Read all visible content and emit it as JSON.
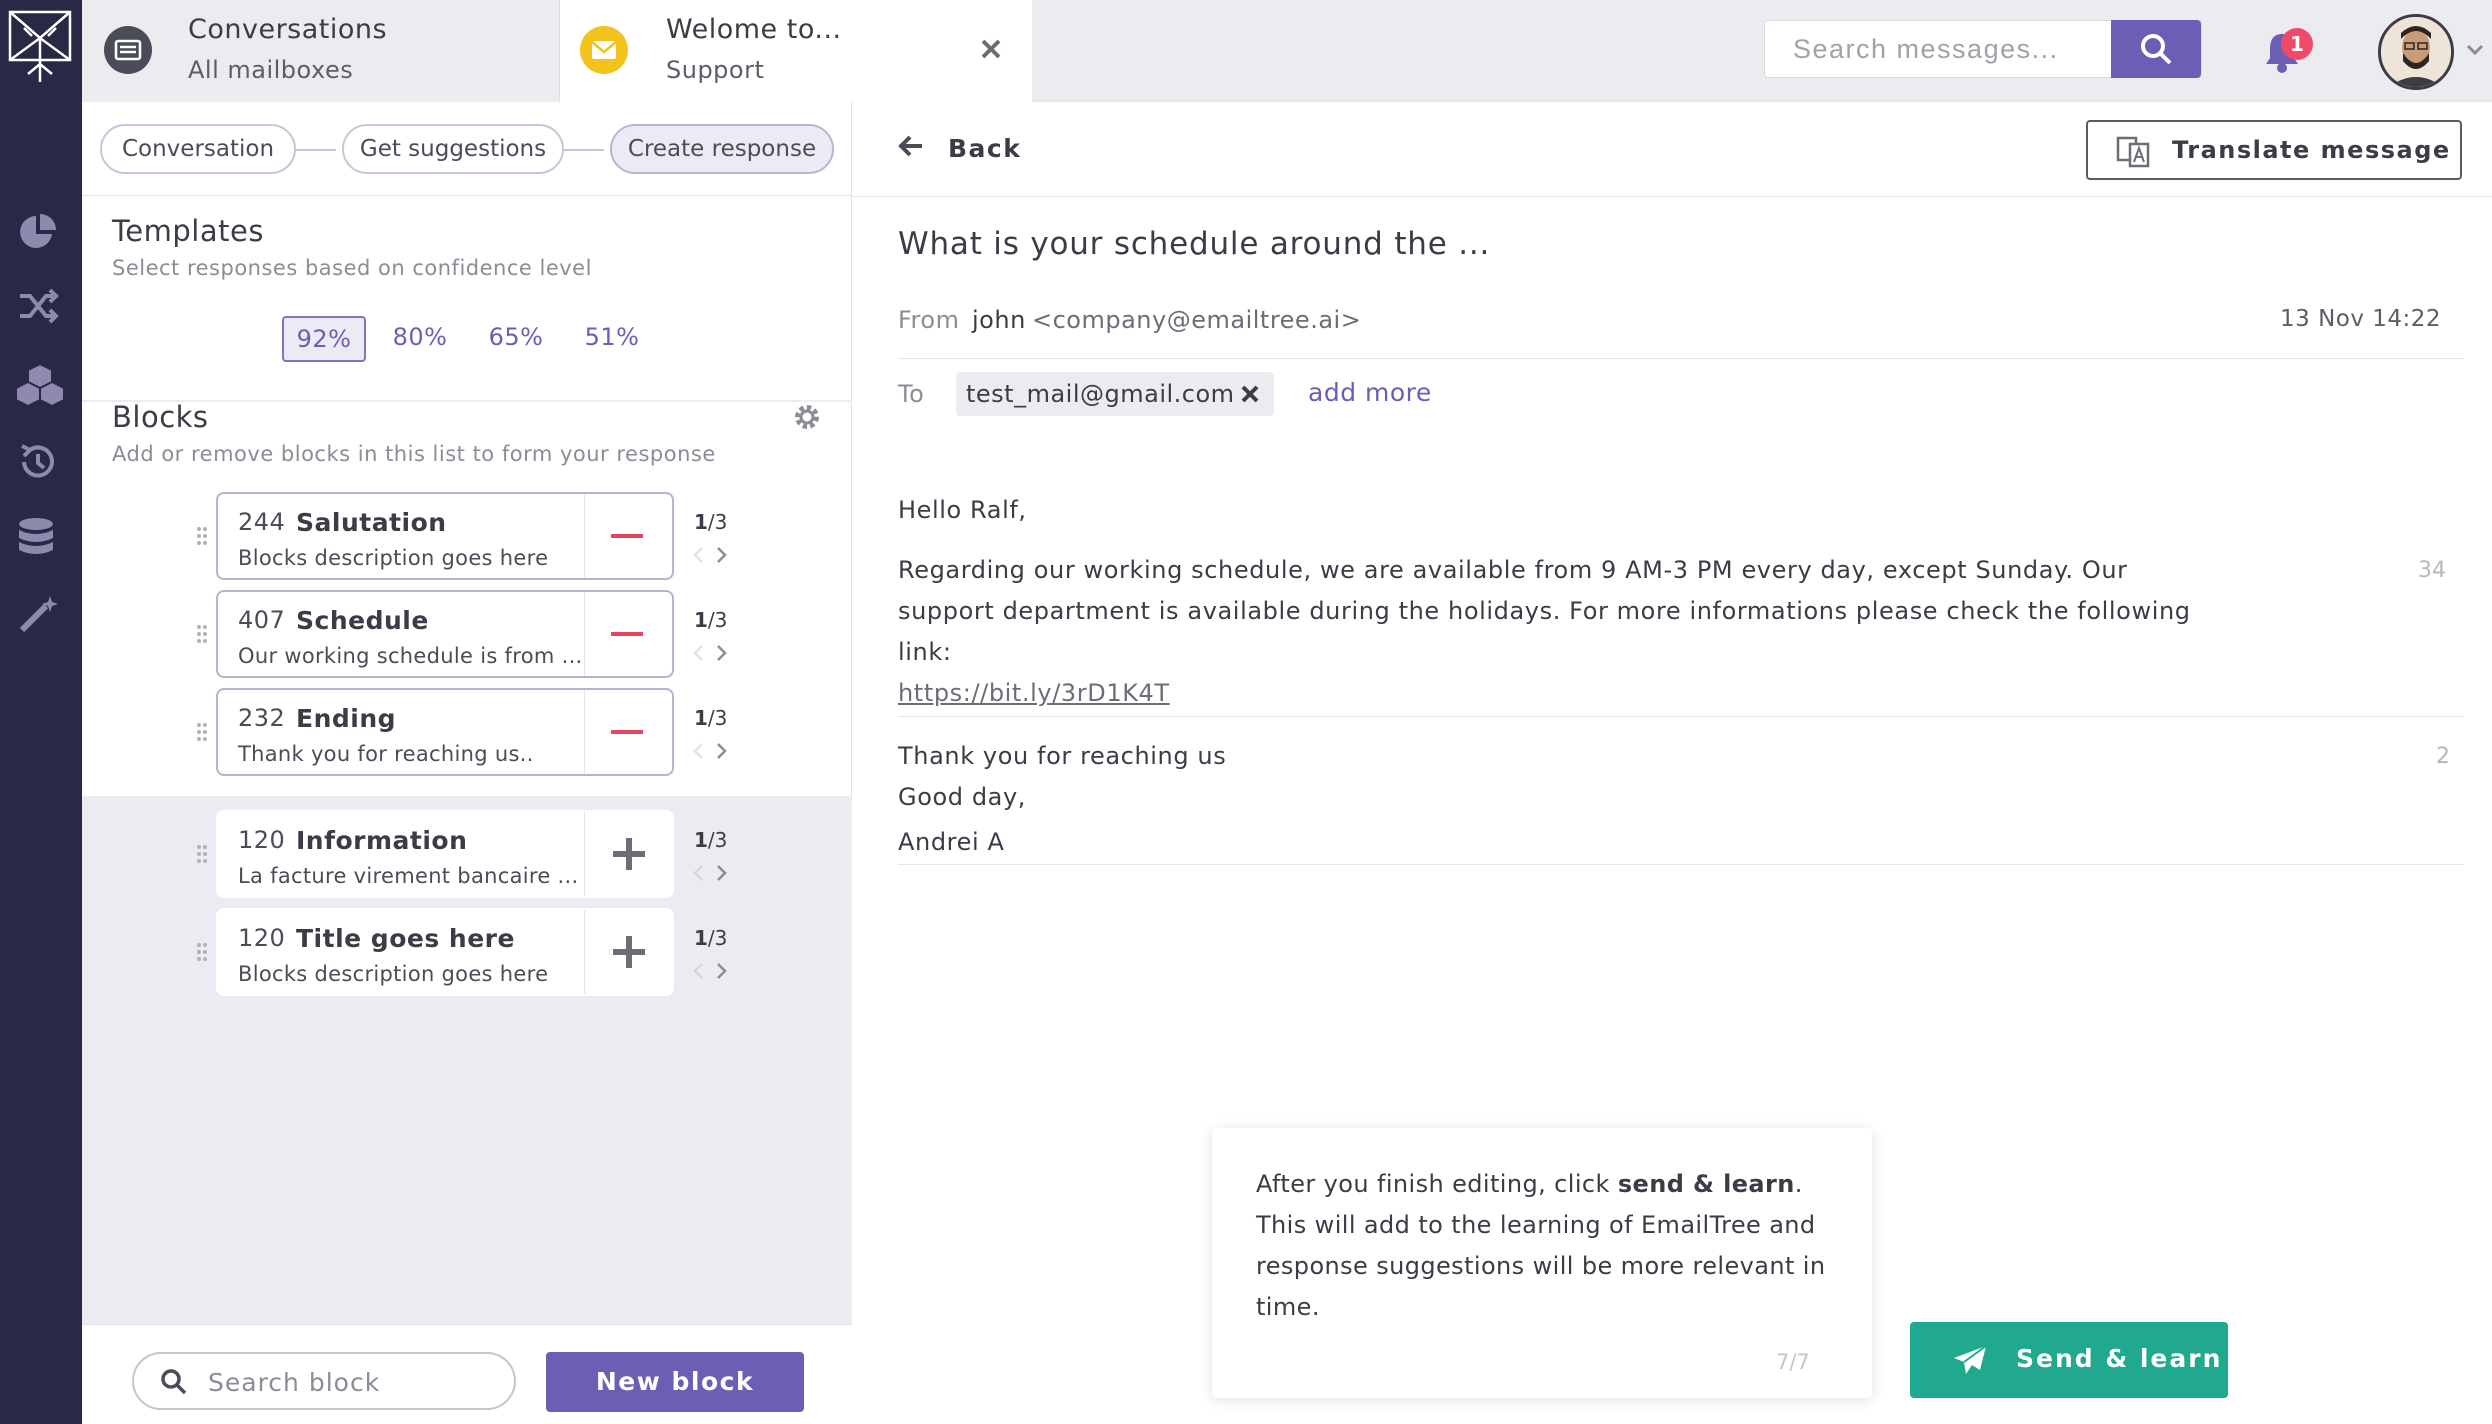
{
  "tabs": [
    {
      "title": "Conversations",
      "subtitle": "All mailboxes",
      "icon": "inbox-icon"
    },
    {
      "title": "Welome to...",
      "subtitle": "Support",
      "icon": "envelope-icon"
    }
  ],
  "search": {
    "placeholder": "Search messages..."
  },
  "notifications": {
    "count": "1"
  },
  "steps": [
    "Conversation",
    "Get suggestions",
    "Create response"
  ],
  "templates": {
    "title": "Templates",
    "subtitle": "Select responses based on confidence level",
    "levels": [
      "92%",
      "80%",
      "65%",
      "51%"
    ],
    "selected": "92%"
  },
  "blocks": {
    "title": "Blocks",
    "subtitle": "Add or remove blocks in this list to form your response",
    "active": [
      {
        "id": "244",
        "name": "Salutation",
        "desc": "Blocks description goes here",
        "page": "1",
        "of": "/3"
      },
      {
        "id": "407",
        "name": "Schedule",
        "desc": "Our working schedule is from ...",
        "page": "1",
        "of": "/3"
      },
      {
        "id": "232",
        "name": "Ending",
        "desc": "Thank you for reaching us..",
        "page": "1",
        "of": "/3"
      }
    ],
    "available": [
      {
        "id": "120",
        "name": "Information",
        "desc": "La facture virement bancaire ...",
        "page": "1",
        "of": "/3"
      },
      {
        "id": "120",
        "name": "Title goes here",
        "desc": "Blocks description goes here",
        "page": "1",
        "of": "/3"
      }
    ]
  },
  "search_block": {
    "placeholder": "Search block"
  },
  "new_block_label": "New block",
  "message": {
    "back_label": "Back",
    "translate_label": "Translate message",
    "subject": "What is your schedule around the ...",
    "from_label": "From",
    "from_name": "john",
    "from_email": "<company@emailtree.ai>",
    "date": "13 Nov 14:22",
    "to_label": "To",
    "to_email": "test_mail@gmail.com",
    "add_more": "add more",
    "greeting": "Hello Ralf,",
    "para1_line1": "Regarding our working schedule, we are available from 9 AM-3 PM every day, except Sunday. Our",
    "para1_line2": "support department is available during the holidays. For more informations please check the following",
    "para1_line3": "link:",
    "link": "https://bit.ly/3rD1K4T",
    "para1_count": "34",
    "closing1": "Thank you for reaching us",
    "closing2": "Good day,",
    "signature": "Andrei A",
    "closing_count": "2"
  },
  "tooltip": {
    "before": "After you finish editing, click ",
    "bold": "send & learn",
    "after": ". This will add to the learning of EmailTree and response suggestions will be more relevant in time.",
    "step": "7/7"
  },
  "send_label": "Send & learn",
  "colors": {
    "accent": "#6b5fb5",
    "rail": "#2a2847",
    "send": "#21a98f",
    "badge": "#ef4a6a"
  }
}
